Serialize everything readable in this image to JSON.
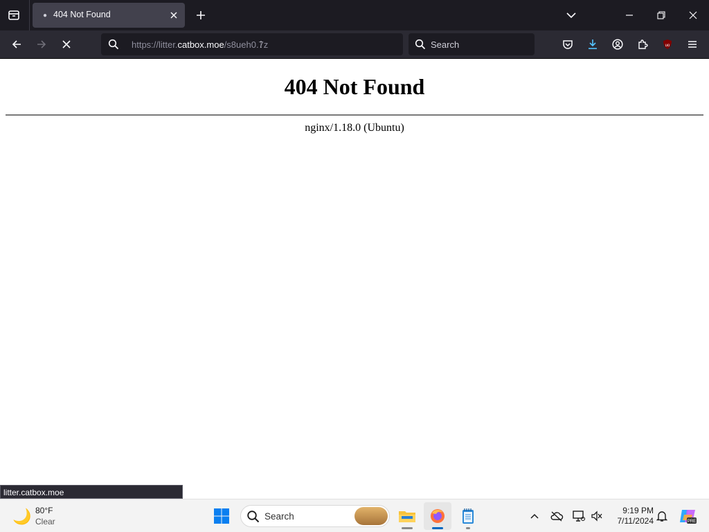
{
  "browser": {
    "tab": {
      "title": "404 Not Found"
    },
    "url": {
      "scheme_prefix": "https://litter.",
      "host": "catbox.moe",
      "path": "/s8ueh0.7z"
    },
    "search": {
      "placeholder": "Search"
    },
    "status_url": "litter.catbox.moe",
    "accent": "#1c1b22"
  },
  "page": {
    "heading": "404 Not Found",
    "server": "nginx/1.18.0 (Ubuntu)"
  },
  "taskbar": {
    "weather": {
      "temp": "80°F",
      "condition": "Clear"
    },
    "search_label": "Search",
    "time": "9:19 PM",
    "date": "7/11/2024"
  }
}
